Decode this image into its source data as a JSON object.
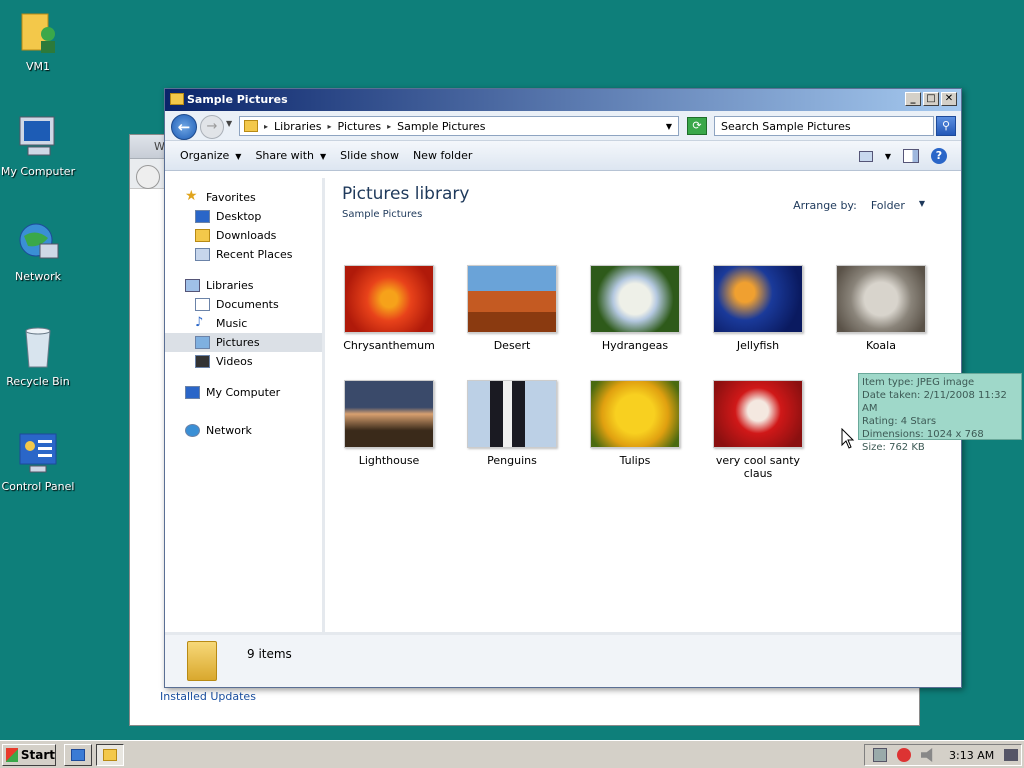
{
  "desktop": {
    "icons": [
      {
        "label": "VM1"
      },
      {
        "label": "My Computer"
      },
      {
        "label": "Network"
      },
      {
        "label": "Recycle Bin"
      },
      {
        "label": "Control Panel"
      }
    ]
  },
  "back_window": {
    "title_fragment": "W",
    "installed_updates": "Installed Updates"
  },
  "window": {
    "title": "Sample Pictures",
    "controls": {
      "minimize": "_",
      "maximize": "□",
      "close": "✕"
    },
    "address": {
      "crumbs": [
        "Libraries",
        "Pictures",
        "Sample Pictures"
      ]
    },
    "search": {
      "placeholder": "Search Sample Pictures"
    },
    "commands": {
      "organize": "Organize",
      "share_with": "Share with",
      "slide_show": "Slide show",
      "new_folder": "New folder"
    },
    "nav": {
      "favorites": "Favorites",
      "desktop": "Desktop",
      "downloads": "Downloads",
      "recent_places": "Recent Places",
      "libraries": "Libraries",
      "documents": "Documents",
      "music": "Music",
      "pictures": "Pictures",
      "videos": "Videos",
      "my_computer": "My Computer",
      "network": "Network"
    },
    "content": {
      "title": "Pictures library",
      "subtitle": "Sample Pictures",
      "arrange_label": "Arrange by:",
      "arrange_value": "Folder",
      "items": [
        {
          "name": "Chrysanthemum"
        },
        {
          "name": "Desert"
        },
        {
          "name": "Hydrangeas"
        },
        {
          "name": "Jellyfish"
        },
        {
          "name": "Koala"
        },
        {
          "name": "Lighthouse"
        },
        {
          "name": "Penguins"
        },
        {
          "name": "Tulips"
        },
        {
          "name": "very cool santy claus"
        }
      ]
    },
    "status": {
      "count": "9 items"
    }
  },
  "tooltip": {
    "type": "Item type: JPEG image",
    "date": "Date taken: 2/11/2008 11:32 AM",
    "rating": "Rating: 4 Stars",
    "dimensions": "Dimensions: 1024 x 768",
    "size": "Size: 762 KB"
  },
  "taskbar": {
    "start": "Start",
    "clock": "3:13 AM"
  }
}
